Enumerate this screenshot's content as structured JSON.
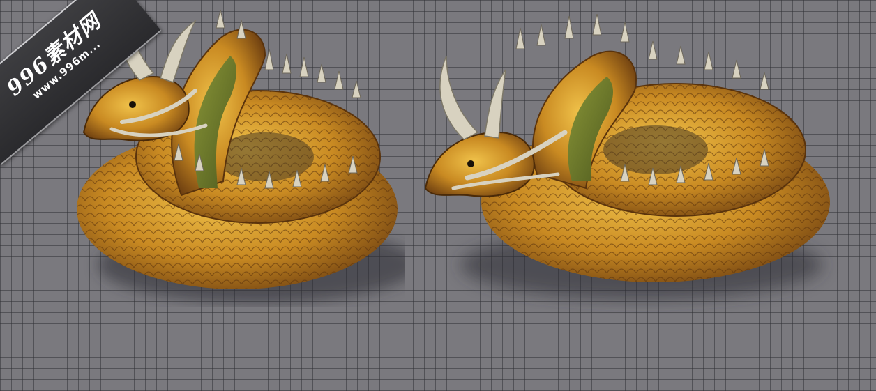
{
  "watermark": {
    "title": "996素材网",
    "url": "www.996m..."
  },
  "sprites": [
    {
      "name": "coiled-golden-dragon",
      "facing": "left",
      "colors": {
        "scale_light": "#e8b640",
        "scale_dark": "#7a4a12",
        "belly": "#6f7a2c",
        "spike": "#d8d2c0"
      }
    },
    {
      "name": "coiled-golden-dragon",
      "facing": "left",
      "colors": {
        "scale_light": "#e8b640",
        "scale_dark": "#7a4a12",
        "belly": "#6f7a2c",
        "spike": "#d8d2c0"
      }
    }
  ],
  "grid": {
    "background": "#7a797e",
    "line": "#323237"
  }
}
